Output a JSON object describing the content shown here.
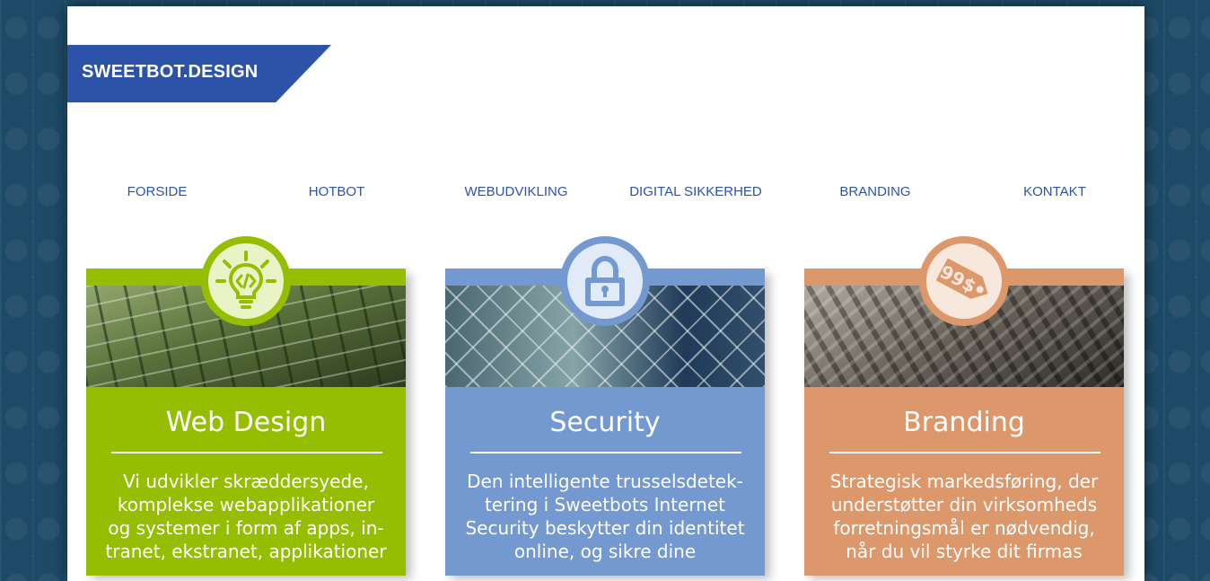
{
  "brand": {
    "logo_text": "SWEETBOT.DESIGN"
  },
  "nav": {
    "items": [
      "FORSIDE",
      "HOTBOT",
      "WEBUDVIKLING",
      "DIGITAL SIKKERHED",
      "BRANDING",
      "KONTAKT"
    ]
  },
  "cards": [
    {
      "title": "Web Design",
      "text": "Vi udvikler skræddersyede, komplekse webapplikationer og systemer i form af apps, in-tranet, ekstranet, applikationer",
      "icon": "lightbulb-code-icon",
      "color": "#95be00"
    },
    {
      "title": "Security",
      "text": "Den intelligente trusselsdetek-tering i Sweetbots Internet Security beskytter din identitet online, og sikre dine",
      "icon": "padlock-icon",
      "color": "#7499d1"
    },
    {
      "title": "Branding",
      "text": "Strategisk markedsføring, der understøtter din virksomheds forretningsmål er nødvendig, når du vil styrke dit firmas",
      "icon": "price-tag-icon",
      "tag_text": "99$",
      "color": "#dc976a"
    }
  ]
}
